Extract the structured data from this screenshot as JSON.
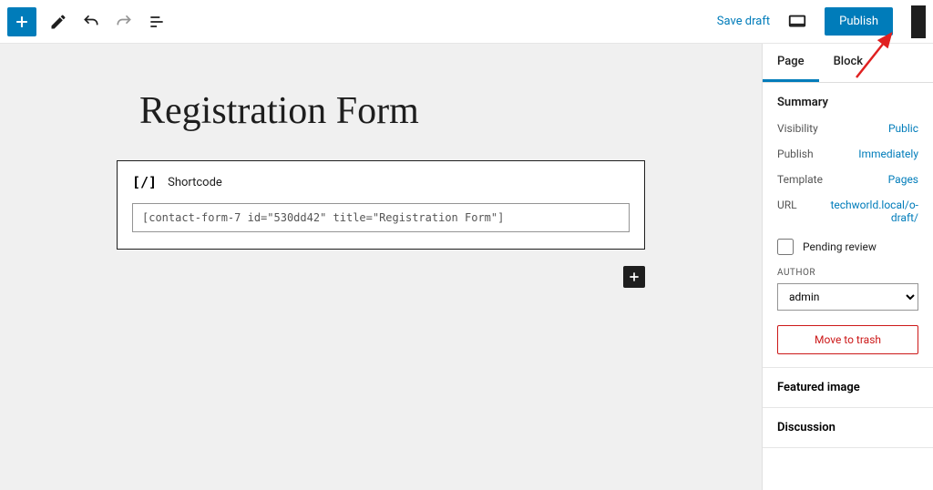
{
  "toolbar": {
    "save_draft": "Save draft",
    "publish": "Publish"
  },
  "content": {
    "page_title": "Registration Form",
    "shortcode_label": "Shortcode",
    "shortcode_value": "[contact-form-7 id=\"530dd42\" title=\"Registration Form\"]"
  },
  "sidebar": {
    "tabs": {
      "page": "Page",
      "block": "Block"
    },
    "summary": {
      "title": "Summary",
      "visibility_label": "Visibility",
      "visibility_value": "Public",
      "publish_label": "Publish",
      "publish_value": "Immediately",
      "template_label": "Template",
      "template_value": "Pages",
      "url_label": "URL",
      "url_value": "techworld.local/o-draft/",
      "pending_review": "Pending review",
      "author_label": "AUTHOR",
      "author_value": "admin",
      "trash": "Move to trash"
    },
    "featured_image": "Featured image",
    "discussion": "Discussion"
  }
}
